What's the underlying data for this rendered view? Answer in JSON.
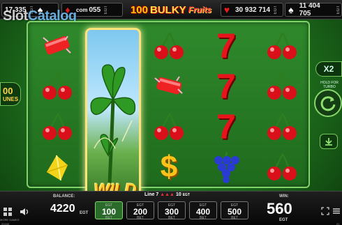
{
  "watermark": {
    "brand_a": "Slot",
    "brand_b": "Catalog"
  },
  "jackpots": [
    {
      "value": "17 335",
      "suit": "spade",
      "egt": "EGT"
    },
    {
      "value": "055",
      "suit": "diamond",
      "egt": "EGT"
    },
    {
      "value": "30 932 714",
      "suit": "heart",
      "egt": "EGT"
    },
    {
      "value": "11 404 705",
      "suit": "spade",
      "egt": "EGT"
    }
  ],
  "jackpot_partial": "com",
  "game_title": {
    "number": "100",
    "word": "BULKY",
    "script": "Fruits"
  },
  "reels": [
    [
      "cherry-burst",
      "cherry",
      "cherry",
      "lemon"
    ],
    [
      "wild",
      "wild",
      "wild",
      "wild"
    ],
    [
      "cherry",
      "cherry-burst",
      "cherry",
      "dollar"
    ],
    [
      "seven",
      "seven",
      "seven",
      "grapes"
    ],
    [
      "cherry",
      "cherry",
      "cherry",
      "cherry"
    ]
  ],
  "wild_label": "WILD",
  "left_badge": {
    "line1": "00",
    "line2": "UNES"
  },
  "right_panel": {
    "multiplier": "X2",
    "hold_text": "HOLD FOR TURBO"
  },
  "bottom": {
    "balance_label": "BALANCE:",
    "balance": "4220",
    "balance_unit": "EGT",
    "line_text": "Line 7",
    "line_win": "10",
    "line_unit": "EGT",
    "win_label": "WIN:",
    "win": "560",
    "win_unit": "EGT",
    "more_games": "MORE GAMES",
    "bets": [
      {
        "egt": "EGT",
        "value": "100",
        "bet": "BET",
        "active": true
      },
      {
        "egt": "EGT",
        "value": "200",
        "bet": "BET",
        "active": false
      },
      {
        "egt": "EGT",
        "value": "300",
        "bet": "BET",
        "active": false
      },
      {
        "egt": "EGT",
        "value": "400",
        "bet": "BET",
        "active": false
      },
      {
        "egt": "EGT",
        "value": "500",
        "bet": "BET",
        "active": false
      }
    ],
    "footer_left": "20240",
    "footer_right": "21"
  },
  "colors": {
    "accent": "#7fd36a",
    "bg": "#1d6a1c",
    "gold": "#ffcf30"
  }
}
